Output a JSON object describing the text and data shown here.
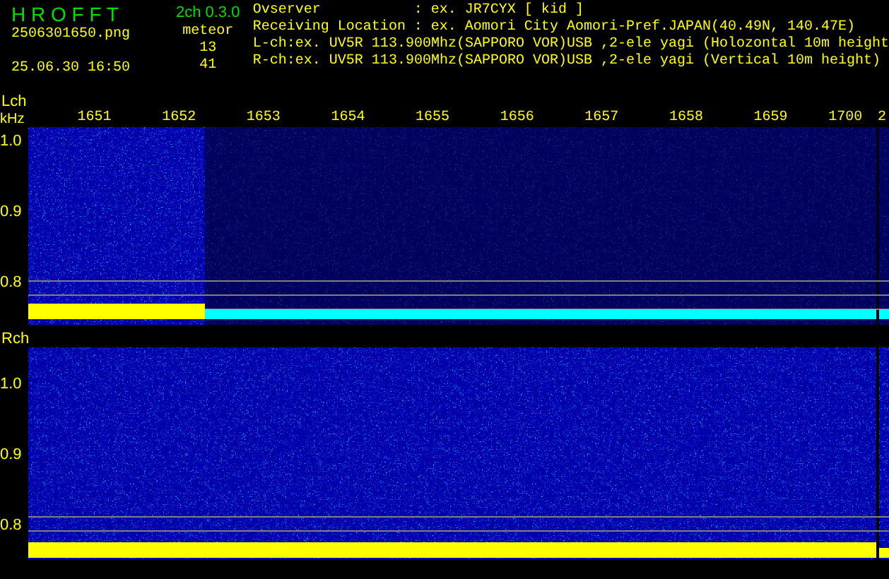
{
  "header": {
    "app_title": "H R O F F T",
    "version": "2ch 0.3.0",
    "filename": "2506301650.png",
    "datetime": "25.06.30 16:50",
    "meteor_label": "meteor",
    "meteor_counts": [
      "13",
      "41"
    ],
    "info_rows": [
      {
        "label": "Ovserver",
        "value": ": ex. JR7CYX [ kid ]"
      },
      {
        "label": "Receiving Location",
        "value": ": ex. Aomori City Aomori-Pref.JAPAN(40.49N, 140.47E)"
      }
    ],
    "channel_lines": [
      "L-ch:ex. UV5R 113.900Mhz(SAPPORO VOR)USB ,2-ele yagi (Holozontal 10m height",
      "R-ch:ex. UV5R 113.900Mhz(SAPPORO VOR)USB ,2-ele yagi (Vertical 10m height)"
    ]
  },
  "time_axis": [
    "1651",
    "1652",
    "1653",
    "1654",
    "1655",
    "1656",
    "1657",
    "1658",
    "1659",
    "1700",
    "2"
  ],
  "panels": [
    {
      "name": "Lch",
      "unit": "kHz",
      "yticks": [
        "1.0",
        "0.9",
        "0.8"
      ],
      "kind": "left"
    },
    {
      "name": "Rch",
      "yticks": [
        "1.0",
        "0.9",
        "0.8"
      ],
      "kind": "right"
    }
  ]
}
